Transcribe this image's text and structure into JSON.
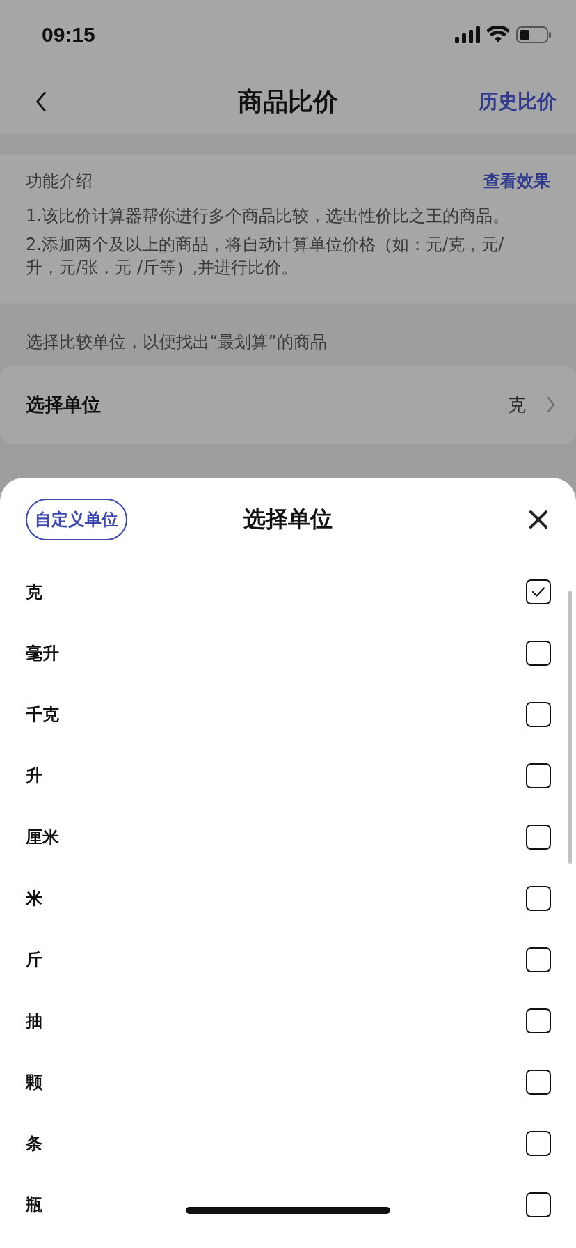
{
  "status_bar": {
    "time": "09:15"
  },
  "nav": {
    "title": "商品比价",
    "action": "历史比价"
  },
  "intro": {
    "title": "功能介绍",
    "link": "查看效果",
    "paragraphs": [
      "1.该比价计算器帮你进行多个商品比较，选出性价比之王的商品。",
      "2.添加两个及以上的商品，将自动计算单位价格（如：元/克，元/升，元/张，元 /斤等）,并进行比价。"
    ]
  },
  "hint": "选择比较单位，以便找出“最划算”的商品",
  "unit_row": {
    "label": "选择单位",
    "value": "克"
  },
  "sheet": {
    "custom_button": "自定义单位",
    "title": "选择单位",
    "units": [
      {
        "label": "克",
        "checked": true
      },
      {
        "label": "毫升",
        "checked": false
      },
      {
        "label": "千克",
        "checked": false
      },
      {
        "label": "升",
        "checked": false
      },
      {
        "label": "厘米",
        "checked": false
      },
      {
        "label": "米",
        "checked": false
      },
      {
        "label": "斤",
        "checked": false
      },
      {
        "label": "抽",
        "checked": false
      },
      {
        "label": "颗",
        "checked": false
      },
      {
        "label": "条",
        "checked": false
      },
      {
        "label": "瓶",
        "checked": false
      }
    ]
  }
}
